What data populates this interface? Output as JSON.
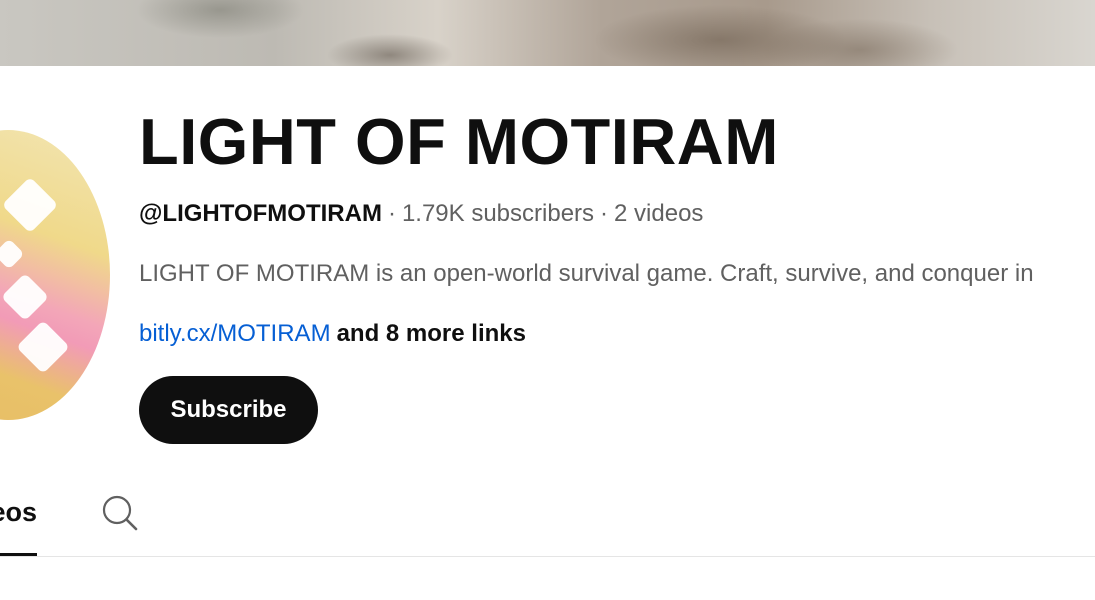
{
  "channel": {
    "name": "LIGHT OF MOTIRAM",
    "handle": "@LIGHTOFMOTIRAM",
    "separator": "·",
    "subscribers": "1.79K subscribers",
    "videos_count": "2 videos",
    "description": "LIGHT OF MOTIRAM is an open-world survival game. Craft, survive, and conquer in",
    "link": "bitly.cx/MOTIRAM",
    "more_links": "and 8 more links",
    "subscribe_label": "Subscribe"
  },
  "tabs": {
    "videos_label": "Videos",
    "search_icon": "search-icon"
  },
  "colors": {
    "link": "#065fd4",
    "button_bg": "#0f0f0f",
    "secondary_text": "#606060"
  }
}
